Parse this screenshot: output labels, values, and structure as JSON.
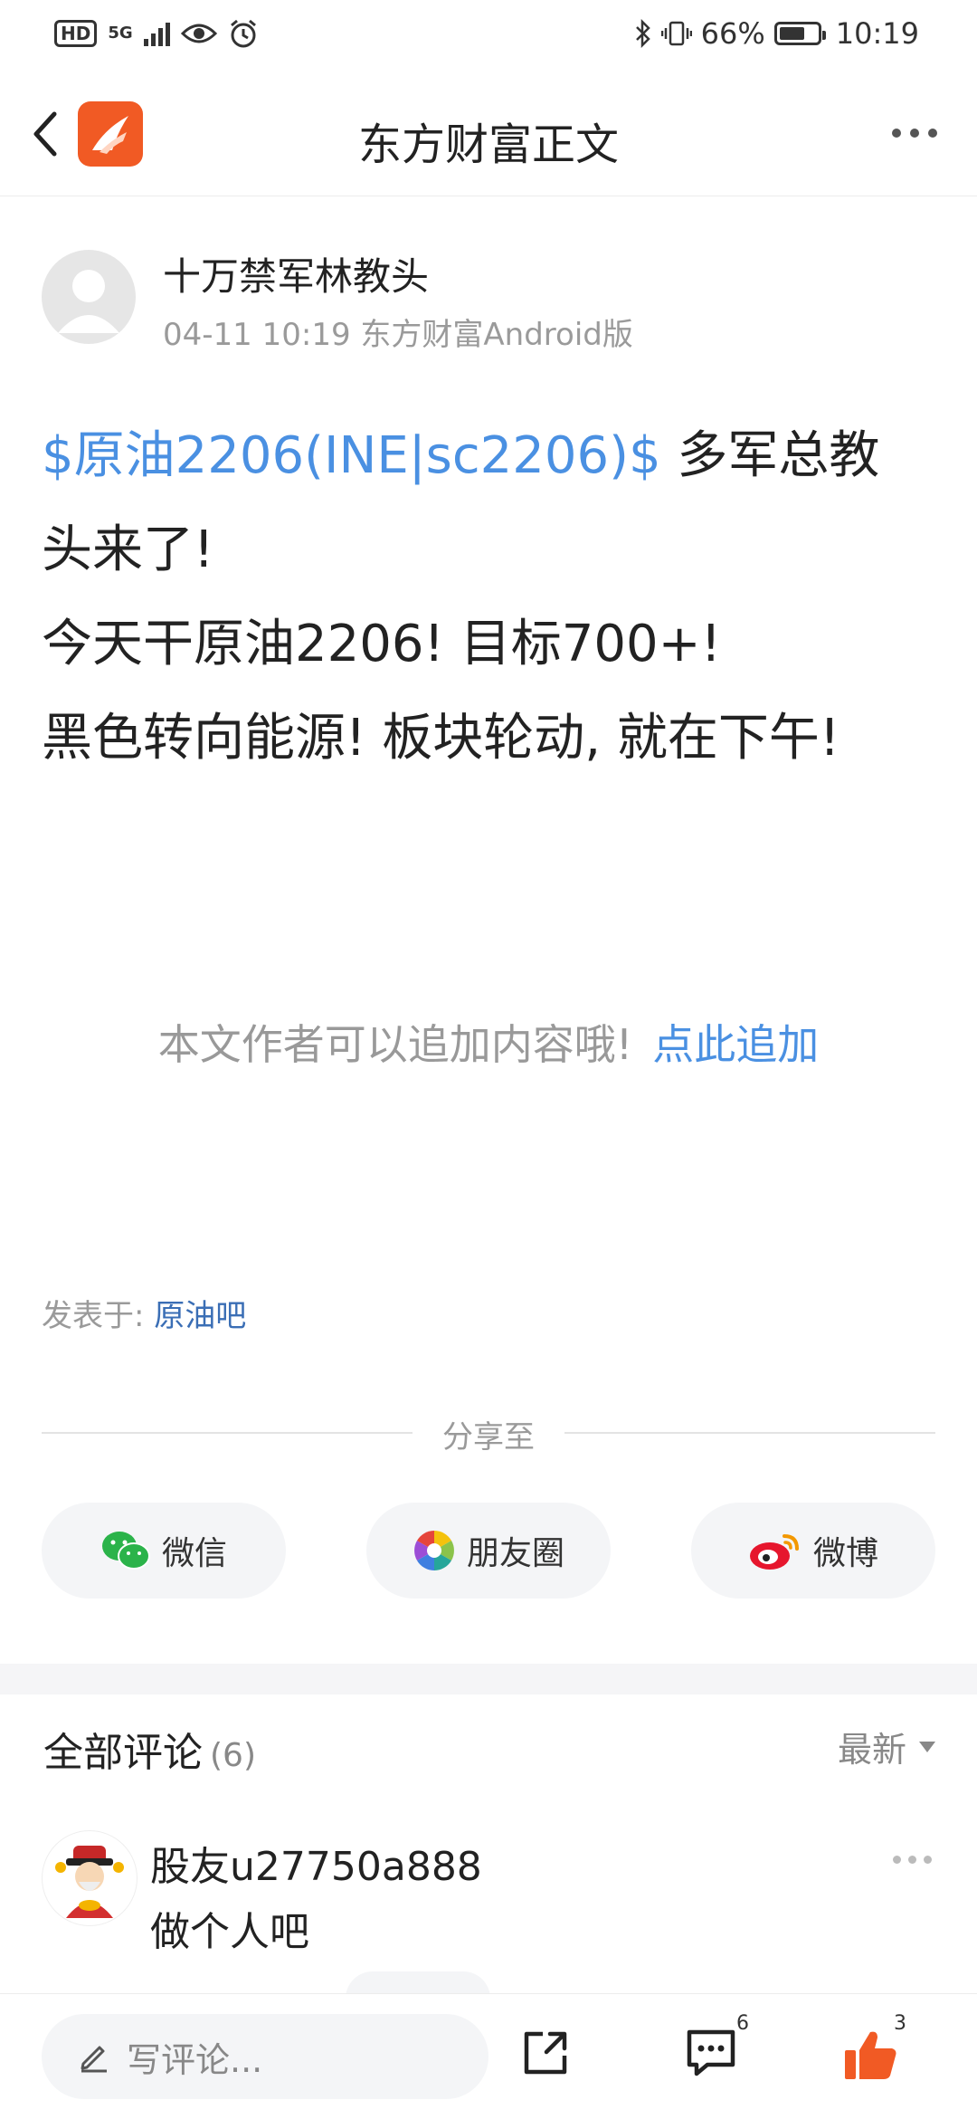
{
  "status": {
    "hd": "HD",
    "network": "5G",
    "battery": "66%",
    "time": "10:19"
  },
  "header": {
    "title": "东方财富正文"
  },
  "post": {
    "author": "十万禁军林教头",
    "meta": "04-11 10:19 东方财富Android版",
    "tag": "$原油2206(INE|sc2206)$",
    "line1_rest": " 多军总教头来了!",
    "line2": "今天干原油2206! 目标700+!",
    "line3": "黑色转向能源! 板块轮动, 就在下午!"
  },
  "append": {
    "text": "本文作者可以追加内容哦!",
    "link": "点此追加"
  },
  "posted_in": {
    "label": "发表于:",
    "link": "原油吧"
  },
  "share": {
    "label": "分享至",
    "wechat": "微信",
    "moments": "朋友圈",
    "weibo": "微博"
  },
  "comments": {
    "title": "全部评论",
    "count": "(6)",
    "sort": "最新",
    "items": [
      {
        "name": "股友u27750a888",
        "text": "做个人吧"
      }
    ]
  },
  "bottom": {
    "placeholder": "写评论...",
    "comment_count": "6",
    "like_count": "3"
  },
  "colors": {
    "accent": "#4a90e2",
    "brand": "#f15a24",
    "like": "#f15a24"
  }
}
